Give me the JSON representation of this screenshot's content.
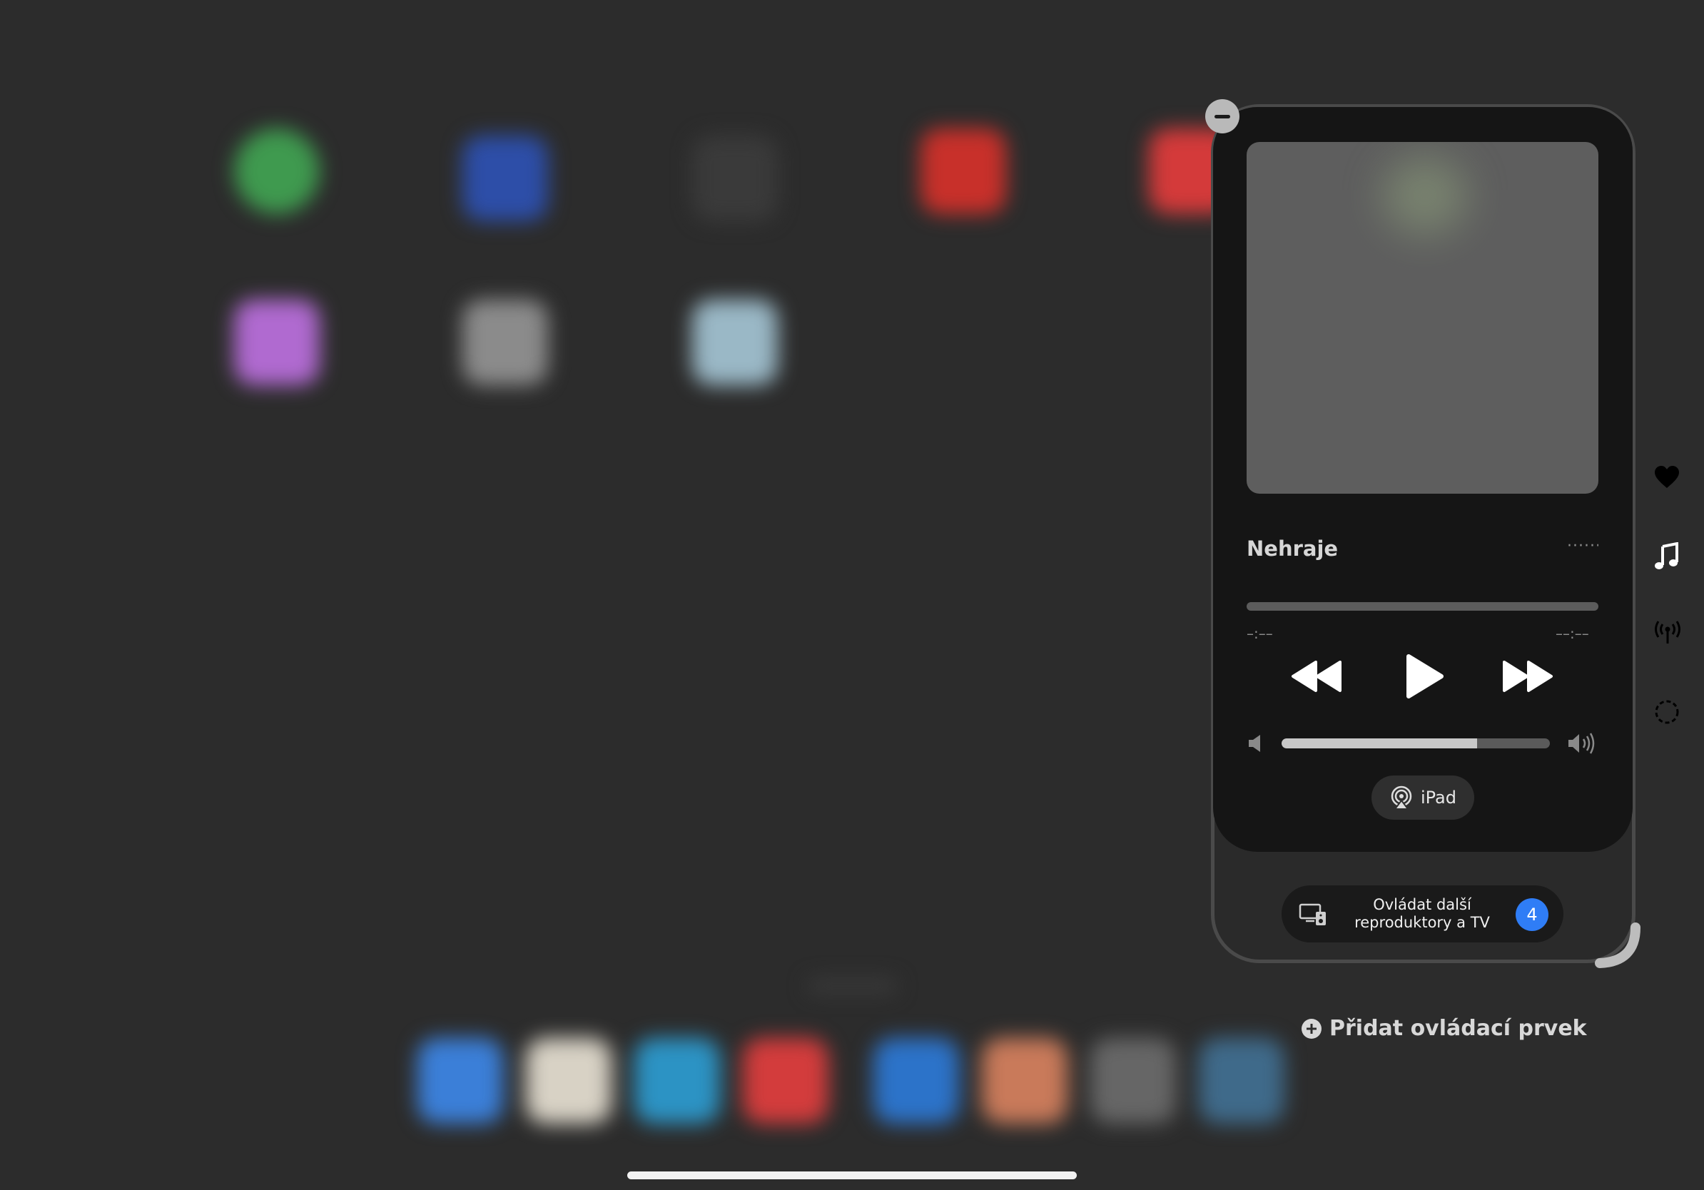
{
  "now_playing": {
    "title": "Nehraje",
    "more": "······",
    "progress": 0,
    "elapsed": "–:––",
    "remaining": "––:––",
    "volume_level": 0.73
  },
  "airplay": {
    "device_label": "iPad"
  },
  "speakers_button": {
    "label_line1": "Ovládat další",
    "label_line2": "reproduktory a TV",
    "badge_count": "4"
  },
  "add_control": {
    "label": "Přidat ovládací prvek"
  },
  "side_icons": [
    "heart-icon",
    "music-note-icon",
    "broadcast-icon",
    "dashed-circle-icon"
  ],
  "colors": {
    "accent_badge": "#2f7df6",
    "background": "#2c2c2c",
    "widget": "#151515"
  }
}
